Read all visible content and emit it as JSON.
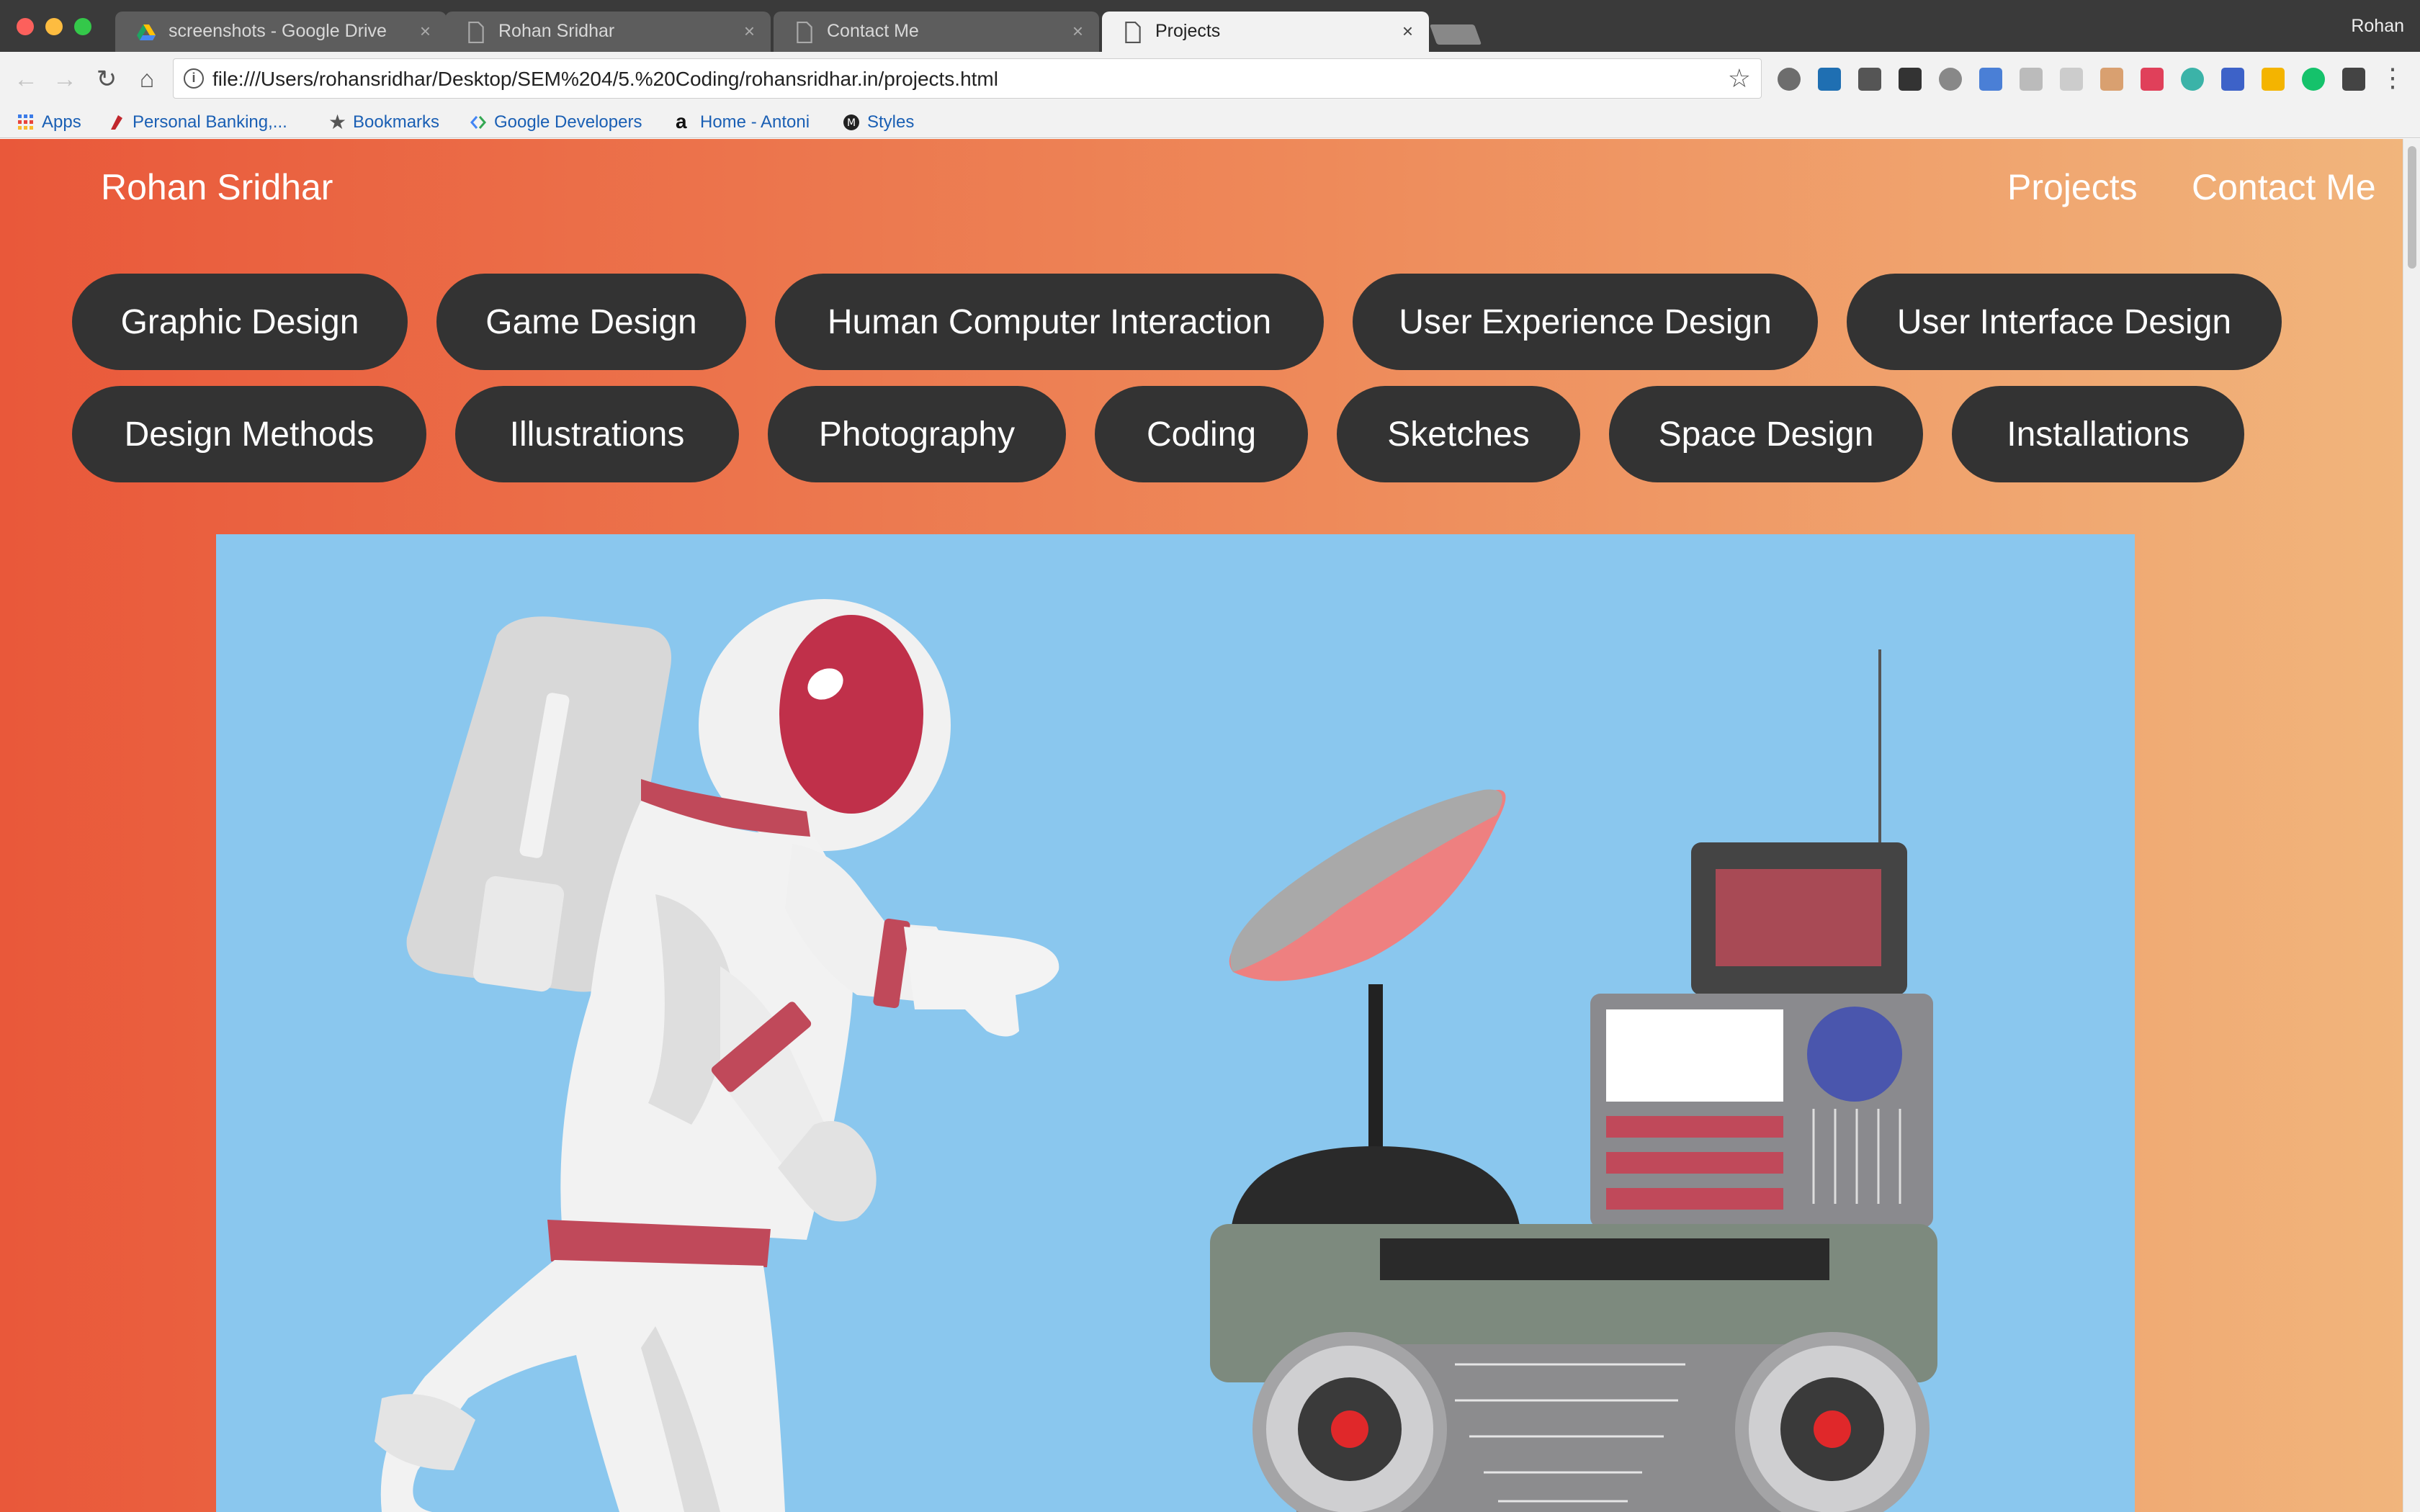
{
  "browser": {
    "tabs": [
      {
        "title": "screenshots - Google Drive",
        "icon": "google-drive-icon",
        "active": false
      },
      {
        "title": "Rohan Sridhar",
        "icon": "page-icon",
        "active": false
      },
      {
        "title": "Contact Me",
        "icon": "page-icon",
        "active": false
      },
      {
        "title": "Projects",
        "icon": "page-icon",
        "active": true
      }
    ],
    "profile_name": "Rohan",
    "url": "file:///Users/rohansridhar/Desktop/SEM%204/5.%20Coding/rohansridhar.in/projects.html",
    "bookmarks": [
      {
        "label": "Apps",
        "icon": "apps-grid-icon"
      },
      {
        "label": "Personal Banking,...",
        "icon": "bank-icon"
      },
      {
        "label": "Bookmarks",
        "icon": "star-icon"
      },
      {
        "label": "Google Developers",
        "icon": "google-developers-icon"
      },
      {
        "label": "Home - Antoni",
        "icon": "amazon-icon"
      },
      {
        "label": "Styles",
        "icon": "medium-icon"
      }
    ],
    "close_glyph": "×",
    "star_glyph": "☆",
    "menu_glyph": "⋮",
    "info_glyph": "i"
  },
  "site": {
    "brand": "Rohan Sridhar",
    "nav": [
      "Projects",
      "Contact Me"
    ],
    "categories": [
      "Graphic Design",
      "Game Design",
      "Human Computer Interaction",
      "User Experience Design",
      "User Interface Design",
      "Design Methods",
      "Illustrations",
      "Photography",
      "Coding",
      "Sketches",
      "Space Design",
      "Installations"
    ]
  },
  "colors": {
    "gradient_start": "#e9583a",
    "gradient_end": "#f1b57c",
    "pill_bg": "#333333",
    "hero_bg": "#8ac7ee",
    "accent_red": "#c0394b"
  }
}
